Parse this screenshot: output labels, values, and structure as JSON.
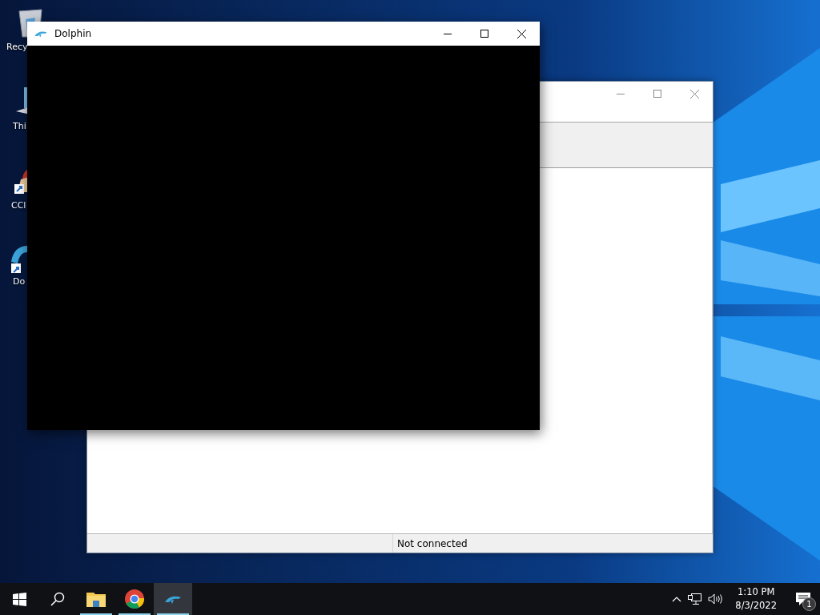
{
  "desktop_icons": [
    {
      "kind": "recycle",
      "label": "Recy"
    },
    {
      "kind": "computer",
      "label": "Thi"
    },
    {
      "kind": "cleaner",
      "label": "CCl"
    },
    {
      "kind": "dolphin",
      "label": "Do"
    }
  ],
  "back_window": {
    "status_bar": "Not connected"
  },
  "front_window": {
    "title": "Dolphin"
  },
  "taskbar": {
    "items": [
      {
        "kind": "start",
        "selected": false,
        "running": false
      },
      {
        "kind": "search",
        "selected": false,
        "running": false
      },
      {
        "kind": "folder",
        "selected": false,
        "running": true
      },
      {
        "kind": "chrome",
        "selected": false,
        "running": true
      },
      {
        "kind": "dolphin",
        "selected": true,
        "running": true
      }
    ],
    "time": "1:10 PM",
    "date": "8/3/2022",
    "notification_count": "1"
  }
}
